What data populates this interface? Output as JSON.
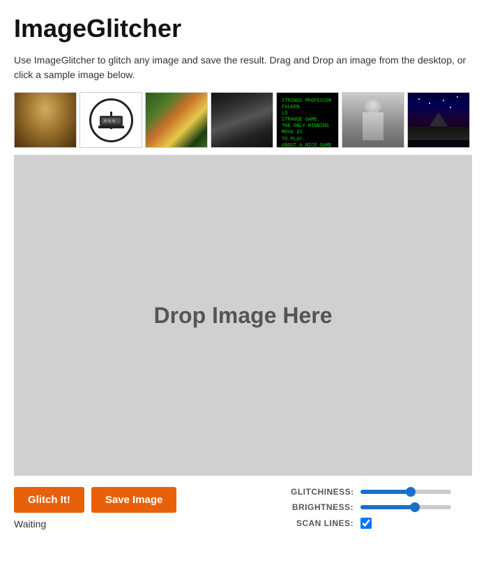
{
  "app": {
    "title": "ImageGlitcher",
    "description": "Use ImageGlitcher to glitch any image and save the result. Drag and Drop an image from the desktop, or click a sample image below."
  },
  "sample_images": [
    {
      "id": "thumb-1",
      "alt": "Girl with pearl earring"
    },
    {
      "id": "thumb-2",
      "alt": "Typewriter logo"
    },
    {
      "id": "thumb-3",
      "alt": "Flowers painting"
    },
    {
      "id": "thumb-4",
      "alt": "Portrait dark"
    },
    {
      "id": "thumb-5",
      "alt": "War games text"
    },
    {
      "id": "thumb-6",
      "alt": "Fashion portrait"
    },
    {
      "id": "thumb-7",
      "alt": "Paramount mountain"
    }
  ],
  "drop_zone": {
    "text": "Drop Image Here"
  },
  "buttons": {
    "glitch": "Glitch It!",
    "save": "Save Image"
  },
  "sliders": {
    "glitchiness_label": "GLITCHINESS:",
    "brightness_label": "BRIGHTNESS:",
    "scan_lines_label": "SCAN LINES:",
    "glitchiness_value": 55,
    "brightness_value": 60,
    "scan_lines_checked": true
  },
  "status": {
    "text": "Waiting"
  }
}
